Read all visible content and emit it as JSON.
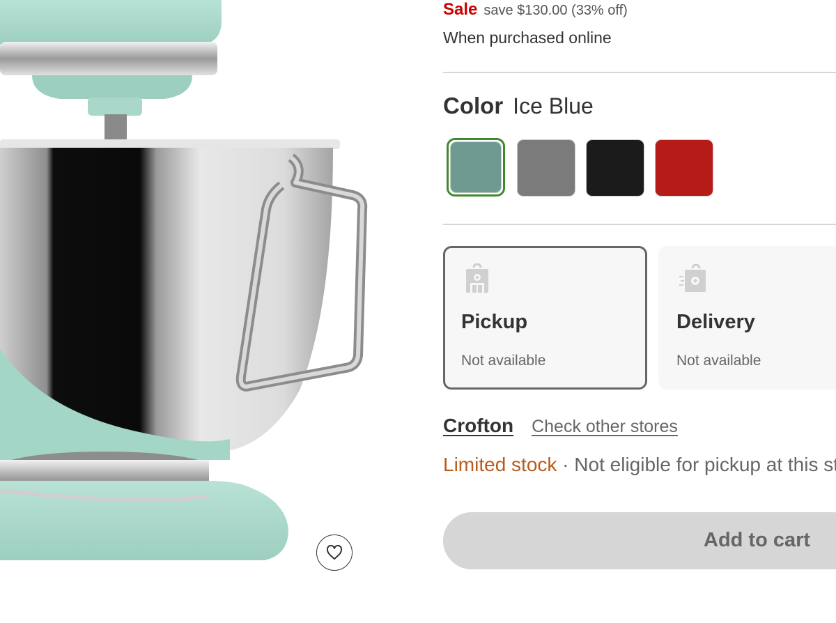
{
  "pricing": {
    "sale_label": "Sale",
    "save_text": "save $130.00 (33% off)",
    "purchase_note": "When purchased online"
  },
  "color": {
    "label": "Color",
    "selected_value": "Ice Blue",
    "swatches": [
      {
        "color": "#6f9a92",
        "selected": true
      },
      {
        "color": "#7b7b7b",
        "selected": false
      },
      {
        "color": "#1b1b1b",
        "selected": false
      },
      {
        "color": "#b51b17",
        "selected": false
      }
    ],
    "selected_border_color": "#3c8a2c"
  },
  "fulfillment": {
    "options": [
      {
        "title": "Pickup",
        "status": "Not available",
        "icon": "pickup-bag-icon",
        "selected": true
      },
      {
        "title": "Delivery",
        "status": "Not available",
        "icon": "delivery-bag-icon",
        "selected": false
      }
    ]
  },
  "store": {
    "name": "Crofton",
    "check_other_label": "Check other stores"
  },
  "stock": {
    "status": "Limited stock",
    "separator": " · ",
    "note": "Not eligible for pickup at this store"
  },
  "cart": {
    "label": "Add to cart",
    "disabled": true
  },
  "favorite": {
    "icon": "heart-icon"
  },
  "colors": {
    "sale_red": "#cc0000",
    "limited_stock_orange": "#b85c1c",
    "divider": "#d6d6d6",
    "button_disabled_bg": "#d6d6d6"
  }
}
